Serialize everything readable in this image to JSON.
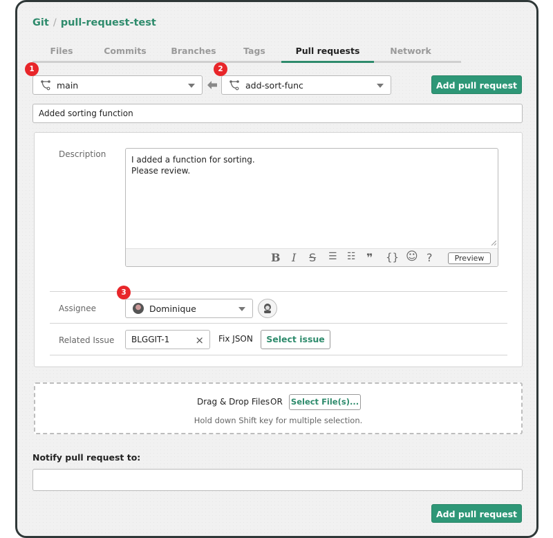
{
  "breadcrumb": {
    "root": "Git",
    "separator": "/",
    "repo": "pull-request-test"
  },
  "tabs": [
    {
      "label": "Files",
      "active": false
    },
    {
      "label": "Commits",
      "active": false
    },
    {
      "label": "Branches",
      "active": false
    },
    {
      "label": "Tags",
      "active": false
    },
    {
      "label": "Pull requests",
      "active": true
    },
    {
      "label": "Network",
      "active": false
    }
  ],
  "badges": [
    "1",
    "2",
    "3"
  ],
  "branches": {
    "target": "main",
    "source": "add-sort-func",
    "arrow_icon": "arrow-left-icon"
  },
  "add_button_label": "Add pull request",
  "title_input": {
    "value": "Added sorting function"
  },
  "description": {
    "label": "Description",
    "value": "I added a function for sorting.\nPlease review.",
    "toolbar": {
      "bold": "B",
      "italic": "I",
      "strike": "S",
      "bullet_list": "☰",
      "numbered_list": "☷",
      "quote": "❞",
      "code": "{}",
      "emoji": "☺",
      "help": "?",
      "preview_label": "Preview"
    }
  },
  "assignee": {
    "label": "Assignee",
    "value": "Dominique"
  },
  "related_issue": {
    "label": "Related Issue",
    "value": "BLGGIT-1",
    "clear_icon": "×",
    "issue_title": "Fix JSON",
    "select_label": "Select issue"
  },
  "attachments": {
    "drag_text": "Drag & Drop Files",
    "or_text": "OR",
    "select_label": "Select File(s)...",
    "hint": "Hold down Shift key for multiple selection."
  },
  "notify": {
    "label": "Notify pull request to:",
    "value": ""
  },
  "colors": {
    "accent": "#2e9777",
    "badge": "#e8262a",
    "frame": "#2f3838"
  }
}
